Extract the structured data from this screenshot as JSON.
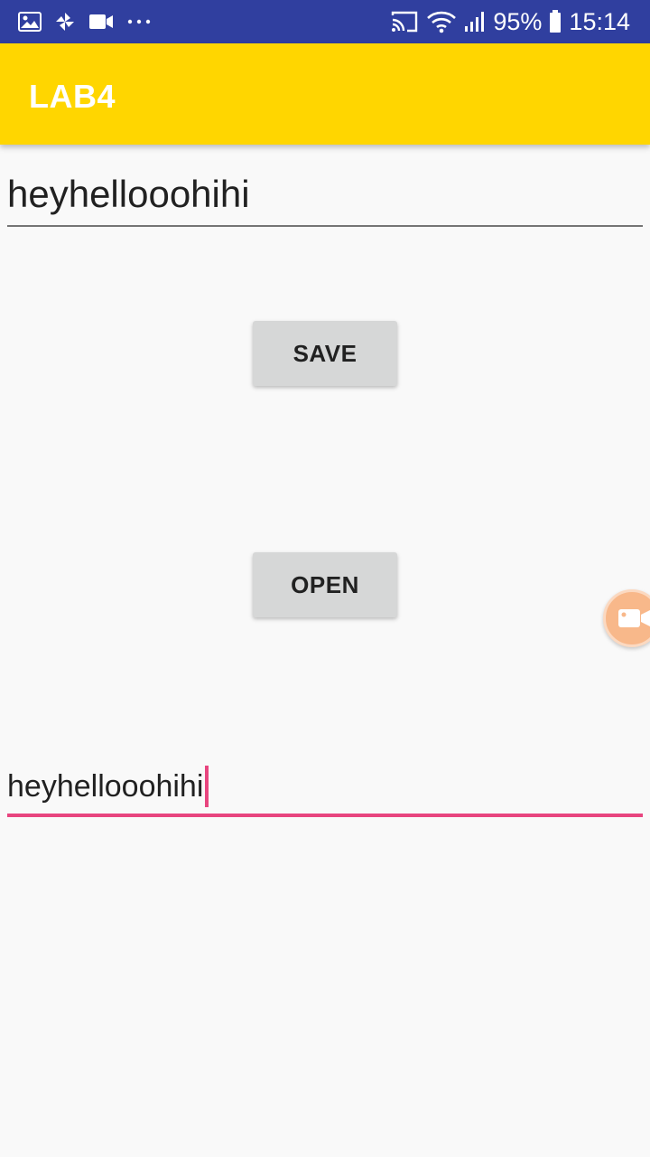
{
  "status_bar": {
    "left_icons": [
      "image-icon",
      "pinwheel-icon",
      "video-camera-icon",
      "more-dots-icon"
    ],
    "right_icons": [
      "cast-icon",
      "wifi-icon",
      "signal-icon",
      "battery-icon"
    ],
    "battery_percent": "95%",
    "time": "15:14",
    "background_color": "#303f9f"
  },
  "app_bar": {
    "title": "LAB4",
    "background_color": "#ffd600"
  },
  "main": {
    "input_top": {
      "value": "heyhellooohihi"
    },
    "save_button": {
      "label": "SAVE"
    },
    "open_button": {
      "label": "OPEN"
    },
    "input_bottom": {
      "value": "heyhellooohihi",
      "accent_color": "#e8457f"
    }
  },
  "floating_button": {
    "icon": "video-camera-icon",
    "color": "#f8b88a"
  }
}
